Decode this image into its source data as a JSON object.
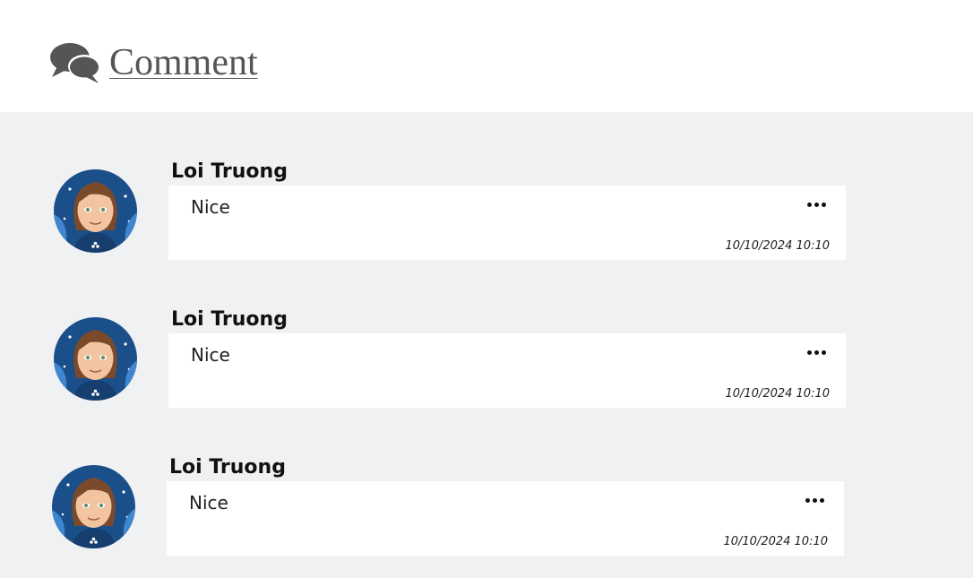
{
  "header": {
    "title": "Comment",
    "icon": "comments-icon",
    "color": "#555555"
  },
  "colors": {
    "area_background": "#f0f1f3",
    "bubble_background": "#ffffff"
  },
  "comments": [
    {
      "author": "Loi Truong",
      "text": "Nice",
      "timestamp": "10/10/2024 10:10",
      "menu_icon": "more-dots-icon"
    },
    {
      "author": "Loi Truong",
      "text": "Nice",
      "timestamp": "10/10/2024 10:10",
      "menu_icon": "more-dots-icon"
    },
    {
      "author": "Loi Truong",
      "text": "Nice",
      "timestamp": "10/10/2024 10:10",
      "menu_icon": "more-dots-icon"
    }
  ]
}
